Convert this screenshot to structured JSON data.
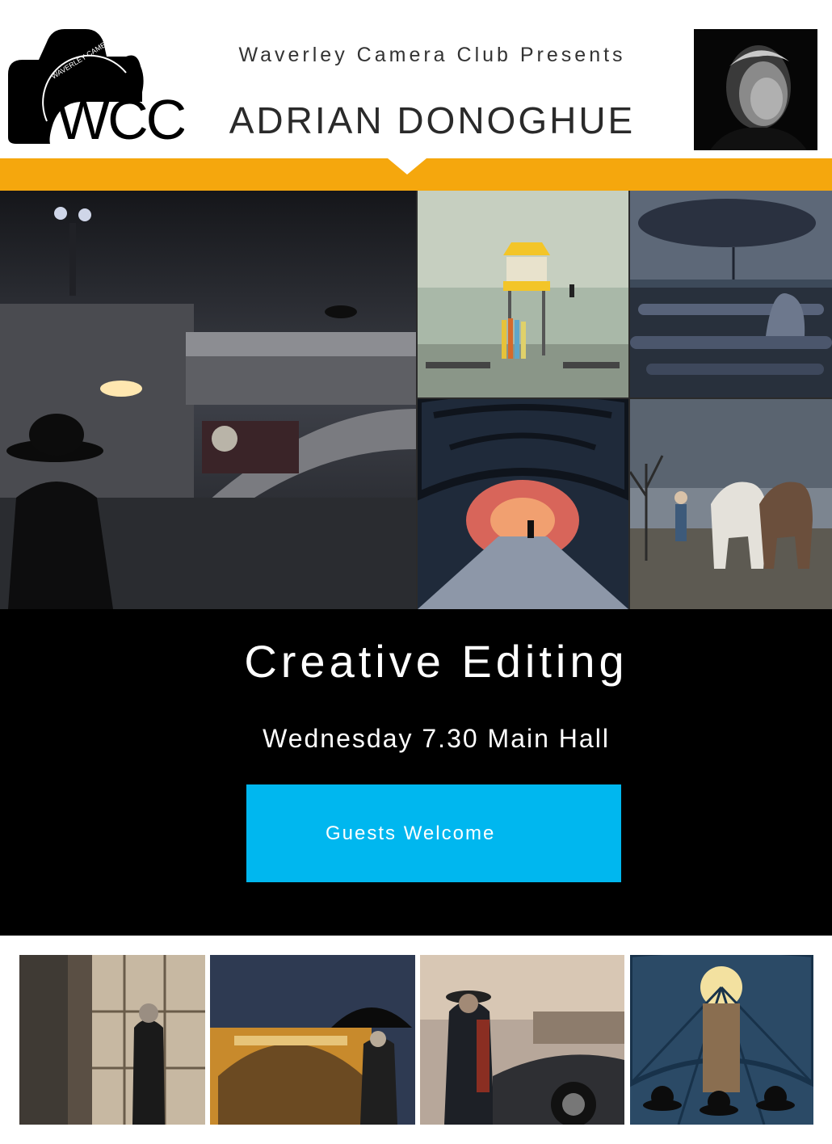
{
  "header": {
    "logo_text": "WCC",
    "logo_arc_text": "WAVERLEY CAMERA CLUB",
    "presents": "Waverley Camera Club Presents",
    "speaker_name": "ADRIAN DONOGHUE"
  },
  "event": {
    "title": "Creative Editing",
    "when": "Wednesday 7.30 Main Hall",
    "cta_label": "Guests Welcome"
  },
  "colors": {
    "accent_orange": "#f5a70d",
    "cta_blue": "#00b7ef",
    "band_black": "#000000"
  },
  "gallery": {
    "main_photos": [
      "rainy-bridge-photo",
      "lifeguard-tower-photo",
      "storm-pipes-photo",
      "walkway-tunnel-photo",
      "ploughing-horses-photo"
    ],
    "strip_photos": [
      "window-man-photo",
      "station-umbrella-photo",
      "vintage-car-photo",
      "dome-hats-photo"
    ]
  }
}
